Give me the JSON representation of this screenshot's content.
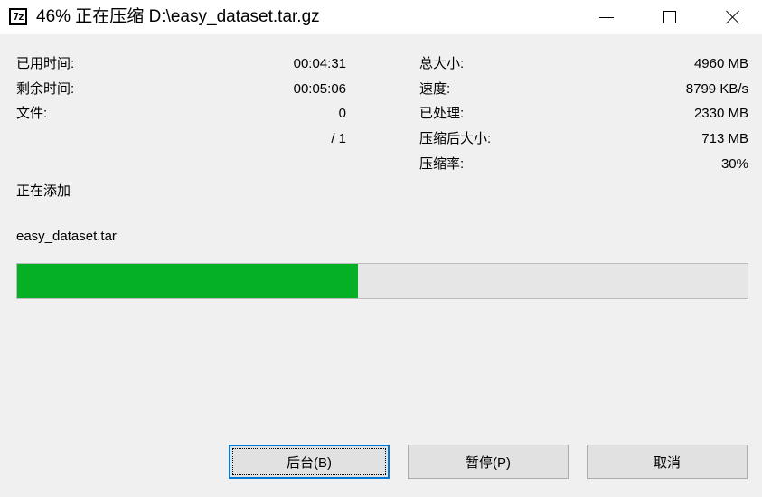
{
  "window": {
    "title": "46% 正在压缩 D:\\easy_dataset.tar.gz",
    "icon_text": "7z"
  },
  "stats_left": [
    {
      "label": "已用时间:",
      "value": "00:04:31"
    },
    {
      "label": "剩余时间:",
      "value": "00:05:06"
    },
    {
      "label": "文件:",
      "value": "0"
    },
    {
      "label": "",
      "value": "/ 1"
    }
  ],
  "stats_right": [
    {
      "label": "总大小:",
      "value": "4960 MB"
    },
    {
      "label": "速度:",
      "value": "8799 KB/s"
    },
    {
      "label": "已处理:",
      "value": "2330 MB"
    },
    {
      "label": "压缩后大小:",
      "value": "713 MB"
    },
    {
      "label": "压缩率:",
      "value": "30%"
    }
  ],
  "status": "正在添加",
  "current_file": "easy_dataset.tar",
  "progress": {
    "fraction": 0.467,
    "color": "#06b025"
  },
  "buttons": {
    "background": "后台(B)",
    "pause": "暂停(P)",
    "cancel": "取消"
  }
}
